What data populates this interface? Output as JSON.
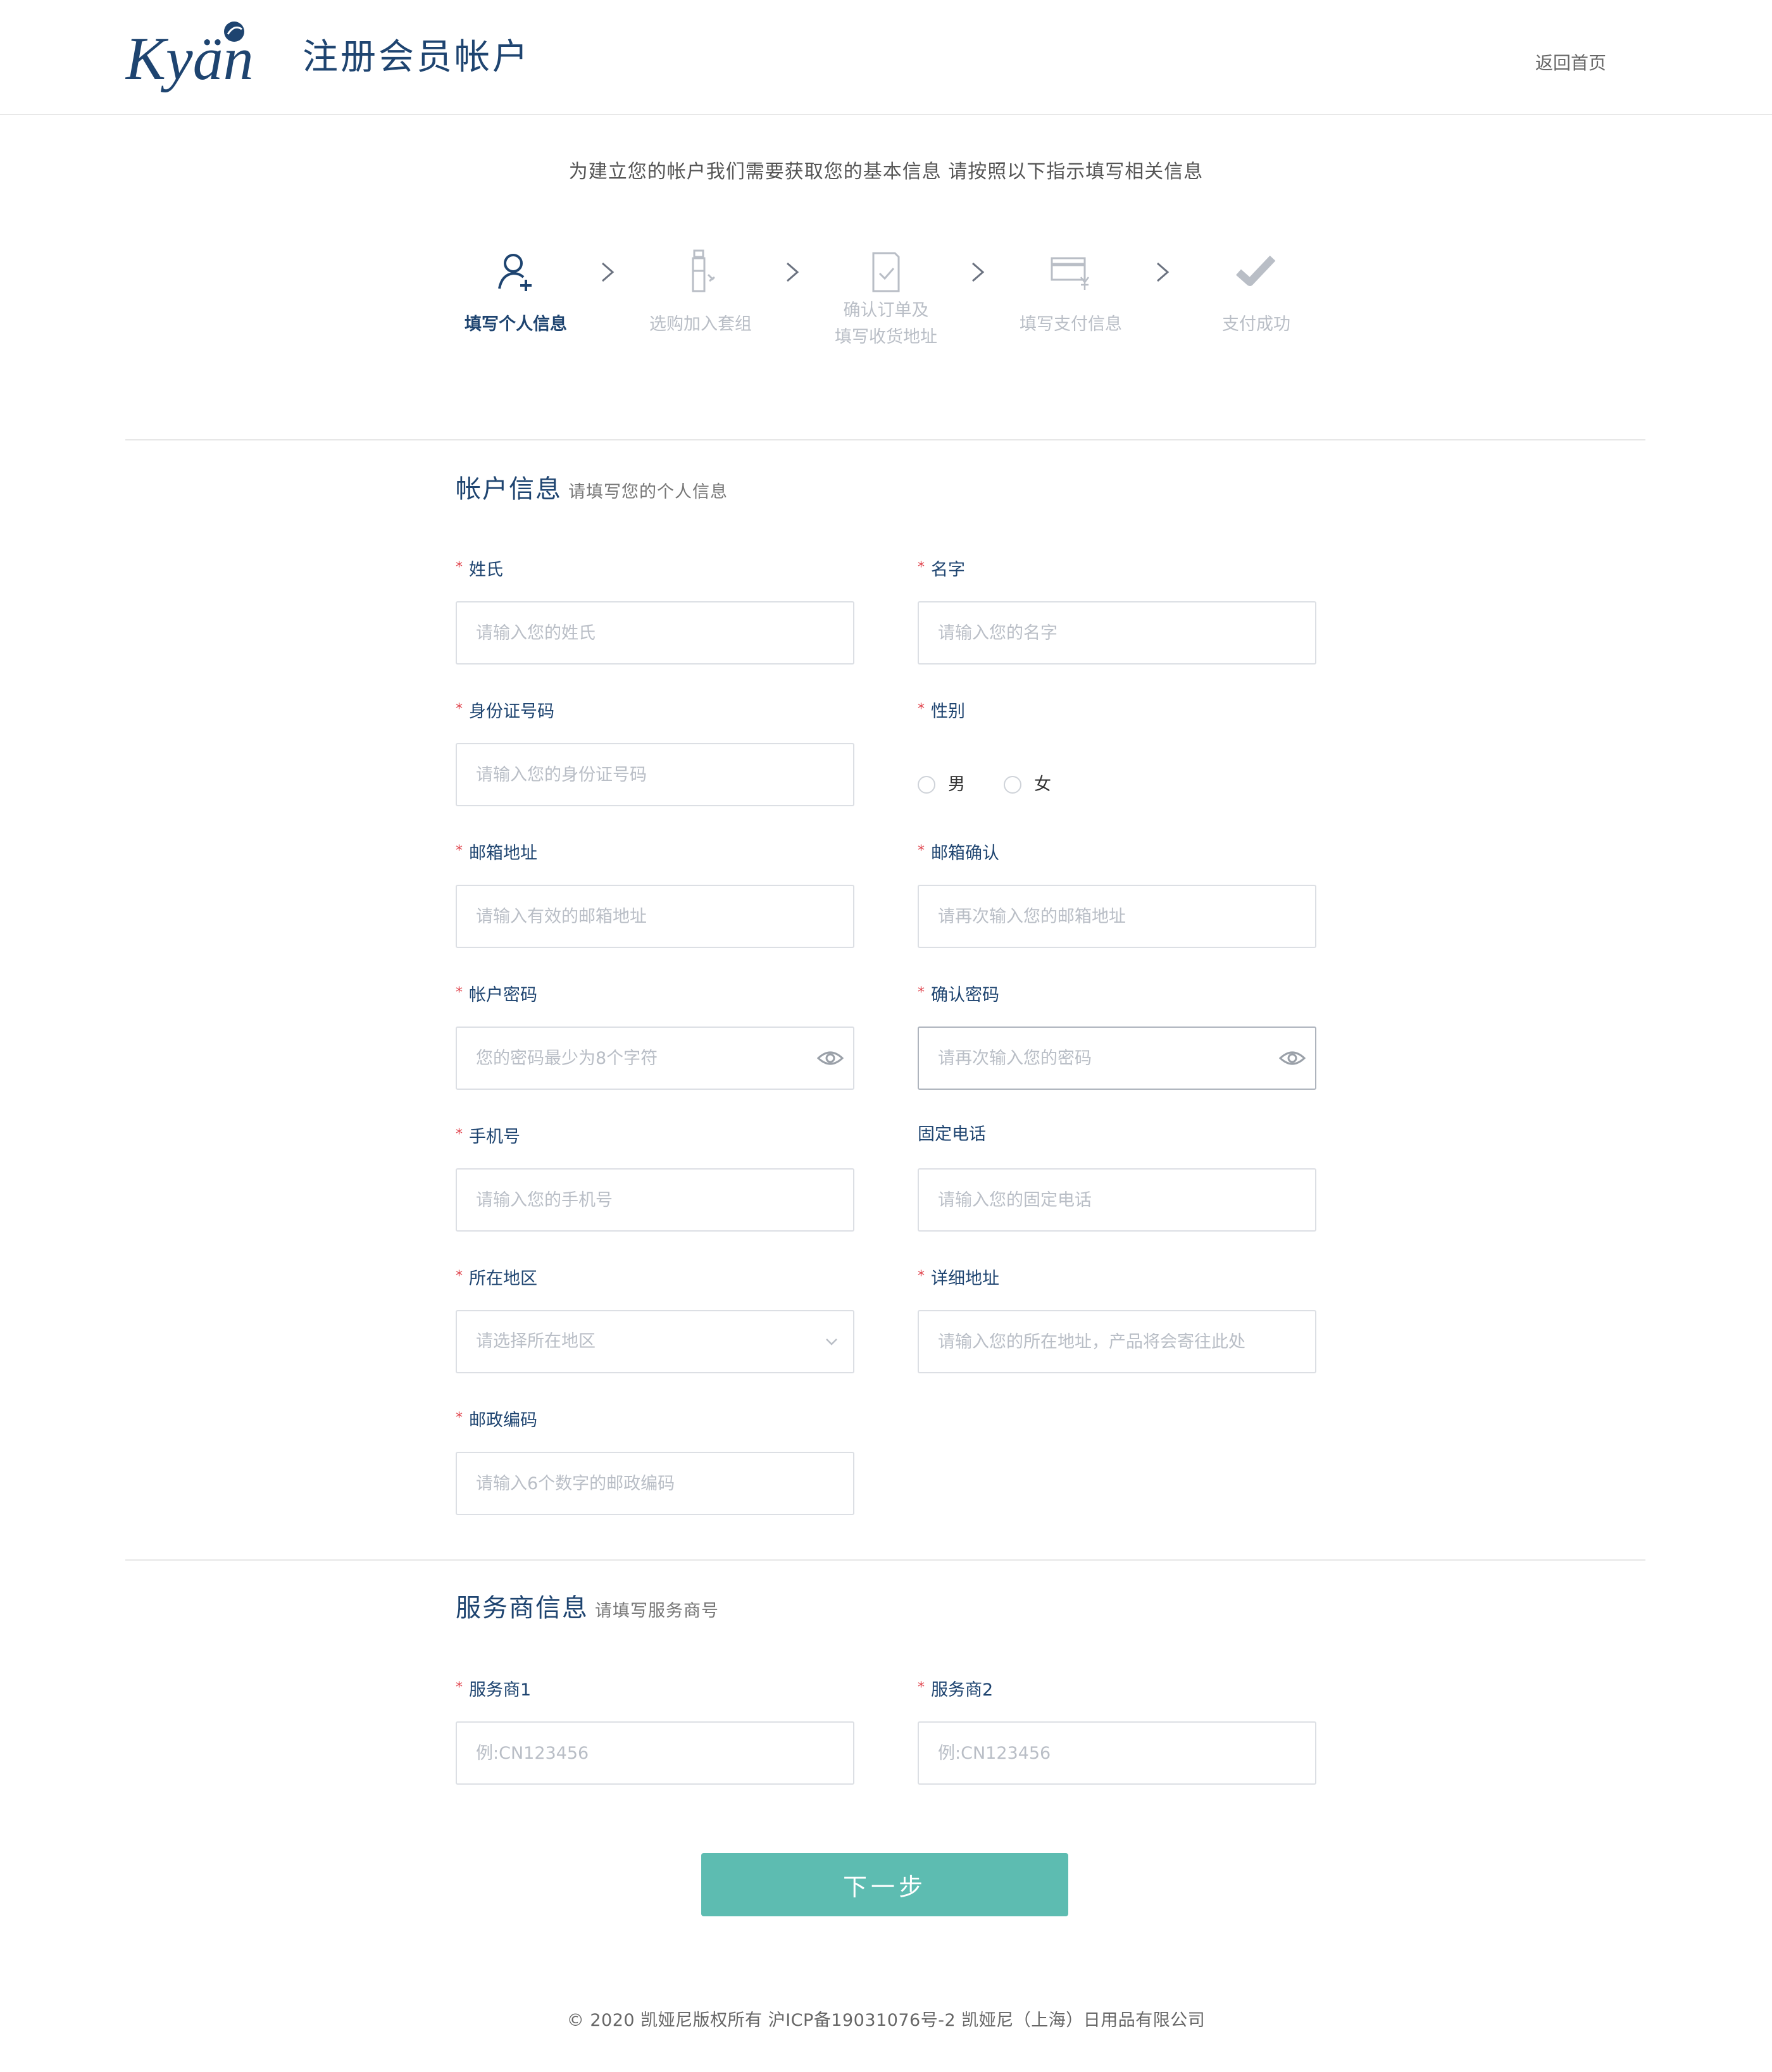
{
  "header": {
    "logo_text": "Kyäni",
    "title": "注册会员帐户",
    "home_link": "返回首页"
  },
  "intro": "为建立您的帐户我们需要获取您的基本信息 请按照以下指示填写相关信息",
  "steps": [
    {
      "icon": "user-add-icon",
      "label": "填写个人信息",
      "active": true
    },
    {
      "icon": "bottle-icon",
      "label": "选购加入套组",
      "active": false
    },
    {
      "icon": "order-check-icon",
      "label_line1": "确认订单及",
      "label_line2": "填写收货地址",
      "active": false
    },
    {
      "icon": "payment-card-icon",
      "label": "填写支付信息",
      "active": false
    },
    {
      "icon": "checkmark-icon",
      "label": "支付成功",
      "active": false
    }
  ],
  "account_section": {
    "title": "帐户信息",
    "subtitle": "请填写您的个人信息"
  },
  "fields": {
    "last_name": {
      "label": "姓氏",
      "placeholder": "请输入您的姓氏"
    },
    "first_name": {
      "label": "名字",
      "placeholder": "请输入您的名字"
    },
    "id_number": {
      "label": "身份证号码",
      "placeholder": "请输入您的身份证号码"
    },
    "gender": {
      "label": "性别",
      "options": [
        "男",
        "女"
      ]
    },
    "email": {
      "label": "邮箱地址",
      "placeholder": "请输入有效的邮箱地址"
    },
    "email_confirm": {
      "label": "邮箱确认",
      "placeholder": "请再次输入您的邮箱地址"
    },
    "password": {
      "label": "帐户密码",
      "placeholder": "您的密码最少为8个字符"
    },
    "password_confirm": {
      "label": "确认密码",
      "placeholder": "请再次输入您的密码"
    },
    "mobile": {
      "label": "手机号",
      "placeholder": "请输入您的手机号"
    },
    "landline": {
      "label": "固定电话",
      "placeholder": "请输入您的固定电话"
    },
    "region": {
      "label": "所在地区",
      "placeholder": "请选择所在地区"
    },
    "address": {
      "label": "详细地址",
      "placeholder": "请输入您的所在地址，产品将会寄往此处"
    },
    "postcode": {
      "label": "邮政编码",
      "placeholder": "请输入6个数字的邮政编码"
    }
  },
  "provider_section": {
    "title": "服务商信息",
    "subtitle": "请填写服务商号"
  },
  "provider_fields": {
    "provider1": {
      "label": "服务商1",
      "placeholder": "例:CN123456"
    },
    "provider2": {
      "label": "服务商2",
      "placeholder": "例:CN123456"
    }
  },
  "next_button": "下一步",
  "footer": "© 2020 凯娅尼版权所有  沪ICP备19031076号-2  凯娅尼（上海）日用品有限公司",
  "colors": {
    "brand_navy": "#1e4470",
    "accent_teal": "#5dbcb1",
    "required_red": "#e0434c",
    "inactive_gray": "#b9bec6"
  }
}
